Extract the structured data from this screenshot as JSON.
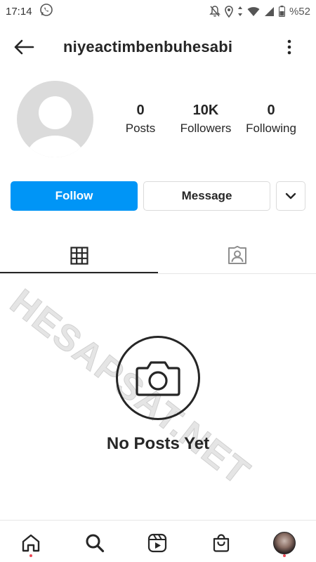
{
  "status_bar": {
    "time": "17:14",
    "battery": "%52"
  },
  "header": {
    "username": "niyeactimbenbuhesabi"
  },
  "stats": {
    "posts": {
      "value": "0",
      "label": "Posts"
    },
    "followers": {
      "value": "10K",
      "label": "Followers"
    },
    "following": {
      "value": "0",
      "label": "Following"
    }
  },
  "actions": {
    "follow_label": "Follow",
    "message_label": "Message"
  },
  "tabs": [
    {
      "icon": "grid-icon",
      "active": true
    },
    {
      "icon": "tagged-person-icon",
      "active": false
    }
  ],
  "empty_state": {
    "icon": "camera-icon",
    "text": "No Posts Yet"
  },
  "watermark": "HESAPSAT.NET",
  "bottom_nav": [
    {
      "icon": "home-icon",
      "notification_dot": true
    },
    {
      "icon": "search-icon",
      "notification_dot": false
    },
    {
      "icon": "reels-icon",
      "notification_dot": false
    },
    {
      "icon": "shop-icon",
      "notification_dot": false
    },
    {
      "icon": "profile-avatar",
      "notification_dot": true
    }
  ],
  "colors": {
    "primary_blue": "#0095f6",
    "text": "#262626",
    "border": "#dbdbdb",
    "notification_red": "#ed4956"
  }
}
